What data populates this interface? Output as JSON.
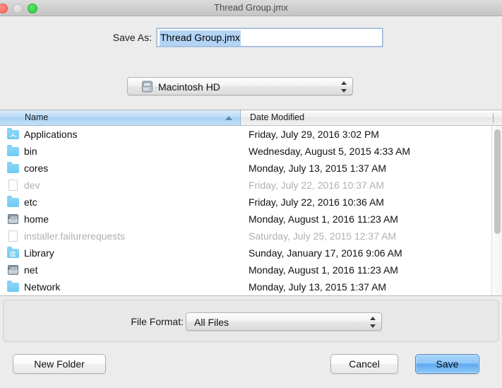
{
  "window": {
    "title": "Thread Group.jmx",
    "traffic_lights": [
      "close-button",
      "minimize-button",
      "zoom-button"
    ]
  },
  "save_as": {
    "label": "Save As:",
    "value": "Thread Group.jmx",
    "placeholder": ""
  },
  "volume": {
    "label": "Macintosh HD",
    "icon": "hard-drive-icon"
  },
  "file_list": {
    "columns": [
      {
        "label": "Name",
        "sorted": "ascending",
        "sort_icon": "sort-ascending-arrow"
      },
      {
        "label": "Date Modified",
        "sorted": "none"
      }
    ],
    "rows": [
      {
        "name": "Applications",
        "date": "Friday, July 29, 2016 3:02 PM",
        "icon": "folder-applications-icon",
        "dimmed": false
      },
      {
        "name": "bin",
        "date": "Wednesday, August 5, 2015 4:33 AM",
        "icon": "folder-icon",
        "dimmed": false
      },
      {
        "name": "cores",
        "date": "Monday, July 13, 2015 1:37 AM",
        "icon": "folder-icon",
        "dimmed": false
      },
      {
        "name": "dev",
        "date": "Friday, July 22, 2016 10:37 AM",
        "icon": "document-icon",
        "dimmed": true
      },
      {
        "name": "etc",
        "date": "Friday, July 22, 2016 10:36 AM",
        "icon": "folder-icon",
        "dimmed": false
      },
      {
        "name": "home",
        "date": "Monday, August 1, 2016 11:23 AM",
        "icon": "drive-icon",
        "dimmed": false
      },
      {
        "name": "installer.failurerequests",
        "date": "Saturday, July 25, 2015 12:37 AM",
        "icon": "document-icon",
        "dimmed": true
      },
      {
        "name": "Library",
        "date": "Sunday, January 17, 2016 9:06 AM",
        "icon": "folder-library-icon",
        "dimmed": false
      },
      {
        "name": "net",
        "date": "Monday, August 1, 2016 11:23 AM",
        "icon": "drive-icon",
        "dimmed": false
      },
      {
        "name": "Network",
        "date": "Monday, July 13, 2015 1:37 AM",
        "icon": "folder-icon",
        "dimmed": false
      }
    ],
    "scrollbar": "vertical-scrollbar"
  },
  "file_format": {
    "label": "File Format:",
    "value": "All Files"
  },
  "buttons": {
    "new_folder": "New Folder",
    "cancel": "Cancel",
    "save": "Save"
  },
  "colors": {
    "selection_blue": "#b3d4f5",
    "default_button_blue": "#5fa9ef",
    "header_sorted_blue": "#a9d1f2",
    "window_chrome": "#ececec",
    "dimmed_text": "#b0b0b0"
  }
}
